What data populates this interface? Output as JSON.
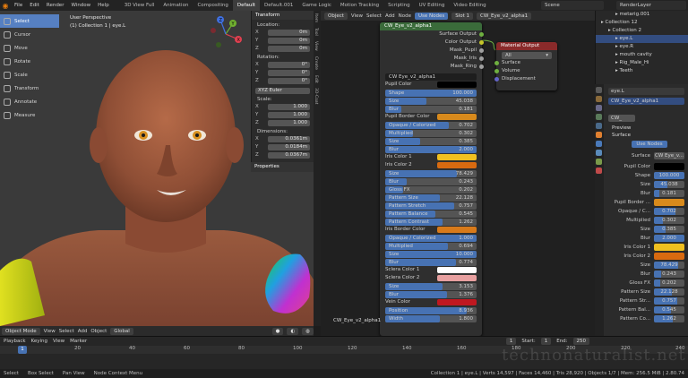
{
  "menubar": {
    "items": [
      "File",
      "Edit",
      "Render",
      "Window",
      "Help"
    ],
    "workspaces": [
      "3D View Full",
      "Animation",
      "Compositing",
      "Default",
      "Default.001",
      "Game Logic",
      "Motion Tracking",
      "Scripting",
      "UV Editing",
      "Video Editing"
    ],
    "active_workspace": "Default",
    "scene": "Scene",
    "view_layer": "RenderLayer"
  },
  "viewport": {
    "tools": [
      "Select",
      "Cursor",
      "Move",
      "Rotate",
      "Scale",
      "Transform",
      "Annotate",
      "Measure"
    ],
    "active_tool": "Select",
    "info_line1": "User Perspective",
    "info_line2": "(1) Collection 1 | eye.L",
    "mode": "Object Mode",
    "menu": [
      "View",
      "Select",
      "Add",
      "Object"
    ],
    "orientation": "Global",
    "gizmo_axes": [
      "X",
      "Y",
      "Z"
    ]
  },
  "npanel": {
    "title": "Transform",
    "location_label": "Location:",
    "location": [
      {
        "k": "X",
        "v": "0m"
      },
      {
        "k": "Y",
        "v": "0m"
      },
      {
        "k": "Z",
        "v": "0m"
      }
    ],
    "rotation_label": "Rotation:",
    "rotation": [
      {
        "k": "X",
        "v": "0°"
      },
      {
        "k": "Y",
        "v": "0°"
      },
      {
        "k": "Z",
        "v": "0°"
      }
    ],
    "rotation_mode": "XYZ Euler",
    "scale_label": "Scale:",
    "scale": [
      {
        "k": "X",
        "v": "1.000"
      },
      {
        "k": "Y",
        "v": "1.000"
      },
      {
        "k": "Z",
        "v": "1.000"
      }
    ],
    "dimensions_label": "Dimensions:",
    "dimensions": [
      {
        "k": "X",
        "v": "0.0361m"
      },
      {
        "k": "Y",
        "v": "0.0184m"
      },
      {
        "k": "Z",
        "v": "0.0367m"
      }
    ],
    "properties_title": "Properties",
    "tabs": [
      "Item",
      "Tool",
      "View",
      "Create",
      "Edit",
      "3D-Coat"
    ]
  },
  "node_editor": {
    "header": [
      "Object",
      "View",
      "Select",
      "Add",
      "Node",
      "Use Nodes"
    ],
    "slot": "Slot 1",
    "material": "CW_Eye_v2_alpha1",
    "group_node": {
      "title": "CW_Eye_v2_alpha1",
      "outputs": [
        "Surface Output",
        "Color Output",
        "Mask_Pupil",
        "Mask_Iris",
        "Mask_Ring"
      ],
      "datablock": "CW Eye_v2_alpha1",
      "params": [
        {
          "type": "color",
          "label": "Pupil Color",
          "color": "#000000"
        },
        {
          "type": "field",
          "label": "Shape",
          "value": "100.000",
          "fill": 1.0
        },
        {
          "type": "field",
          "label": "Size",
          "value": "45.038",
          "fill": 0.45
        },
        {
          "type": "field",
          "label": "Blur",
          "value": "0.181",
          "fill": 0.18
        },
        {
          "type": "color",
          "label": "Pupil Border Color",
          "color": "#d88a1c"
        },
        {
          "type": "field",
          "label": "Opaque / Colorized",
          "value": "0.702",
          "fill": 0.7
        },
        {
          "type": "field",
          "label": "Multiplied",
          "value": "0.302",
          "fill": 0.3
        },
        {
          "type": "field",
          "label": "Size",
          "value": "0.385",
          "fill": 0.38
        },
        {
          "type": "field",
          "label": "Blur",
          "value": "2.000",
          "fill": 1.0
        },
        {
          "type": "color",
          "label": "Iris Color 1",
          "color": "#f0c020"
        },
        {
          "type": "color",
          "label": "Iris Color 2",
          "color": "#d86a10"
        },
        {
          "type": "field",
          "label": "Size",
          "value": "78.429",
          "fill": 0.78
        },
        {
          "type": "field",
          "label": "Blur",
          "value": "0.243",
          "fill": 0.24
        },
        {
          "type": "field",
          "label": "Gloss FX",
          "value": "0.202",
          "fill": 0.2
        },
        {
          "type": "field",
          "label": "Pattern Size",
          "value": "22.128",
          "fill": 0.6
        },
        {
          "type": "field",
          "label": "Pattern Stretch",
          "value": "0.757",
          "fill": 0.75
        },
        {
          "type": "field",
          "label": "Pattern Balance",
          "value": "0.545",
          "fill": 0.55
        },
        {
          "type": "field",
          "label": "Pattern Contrast",
          "value": "1.262",
          "fill": 0.63
        },
        {
          "type": "color",
          "label": "Iris Border Color",
          "color": "#d87a1a"
        },
        {
          "type": "field",
          "label": "Opaque / Colorized",
          "value": "1.000",
          "fill": 1.0
        },
        {
          "type": "field",
          "label": "Multiplied",
          "value": "0.694",
          "fill": 0.69
        },
        {
          "type": "field",
          "label": "Size",
          "value": "10.000",
          "fill": 1.0
        },
        {
          "type": "field",
          "label": "Blur",
          "value": "0.774",
          "fill": 0.77
        },
        {
          "type": "color",
          "label": "Sclera Color 1",
          "color": "#ffffff"
        },
        {
          "type": "color",
          "label": "Sclera Color 2",
          "color": "#e8a0a0"
        },
        {
          "type": "field",
          "label": "Size",
          "value": "3.153",
          "fill": 0.63
        },
        {
          "type": "field",
          "label": "Blur",
          "value": "1.376",
          "fill": 0.68
        },
        {
          "type": "color",
          "label": "Vein Color",
          "color": "#c01820"
        },
        {
          "type": "field",
          "label": "Position",
          "value": "8.936",
          "fill": 0.89
        },
        {
          "type": "field",
          "label": "Width",
          "value": "1.800",
          "fill": 0.6
        }
      ]
    },
    "material_node": {
      "title": "Material Output",
      "target": "All",
      "inputs": [
        "Surface",
        "Volume",
        "Displacement"
      ]
    },
    "footer_label": "CW_Eye_v2_alpha1"
  },
  "outliner": {
    "rows": [
      {
        "label": "metarig.001",
        "sel": false,
        "indent": 2
      },
      {
        "label": "Collection 12",
        "sel": false,
        "indent": 0
      },
      {
        "label": "Collection 2",
        "sel": false,
        "indent": 1
      },
      {
        "label": "eye.L",
        "sel": true,
        "indent": 2
      },
      {
        "label": "eye.R",
        "sel": false,
        "indent": 2
      },
      {
        "label": "mouth cavity",
        "sel": false,
        "indent": 2
      },
      {
        "label": "Rig_Male_Hi",
        "sel": false,
        "indent": 2
      },
      {
        "label": "Teeth",
        "sel": false,
        "indent": 2
      }
    ]
  },
  "properties": {
    "object": "eye.L",
    "material_slot": "CW_Eye_v2_alpha1",
    "material_field": "CW_",
    "preview": "Preview",
    "surface": "Surface",
    "use_nodes": "Use Nodes",
    "surface_label": "Surface",
    "surface_value": "CW Eye_v...",
    "rows": [
      {
        "k": "Pupil Color",
        "type": "color",
        "color": "#000000"
      },
      {
        "k": "Shape",
        "v": "100.000",
        "fill": 1.0
      },
      {
        "k": "Size",
        "v": "45.038",
        "fill": 0.45
      },
      {
        "k": "Blur",
        "v": "0.181",
        "fill": 0.18
      },
      {
        "k": "Pupil Border ...",
        "type": "color",
        "color": "#d88a1c"
      },
      {
        "k": "Opaque / C...",
        "v": "0.702",
        "fill": 0.7
      },
      {
        "k": "Multiplied",
        "v": "0.302",
        "fill": 0.3
      },
      {
        "k": "Size",
        "v": "0.385",
        "fill": 0.38
      },
      {
        "k": "Blur",
        "v": "2.000",
        "fill": 1.0
      },
      {
        "k": "Iris Color 1",
        "type": "color",
        "color": "#f0c020"
      },
      {
        "k": "Iris Color 2",
        "type": "color",
        "color": "#d86a10"
      },
      {
        "k": "Size",
        "v": "78.429",
        "fill": 0.78
      },
      {
        "k": "Blur",
        "v": "0.243",
        "fill": 0.24
      },
      {
        "k": "Gloss FX",
        "v": "0.202",
        "fill": 0.2
      },
      {
        "k": "Pattern Size",
        "v": "22.128",
        "fill": 0.6
      },
      {
        "k": "Pattern Str...",
        "v": "0.757",
        "fill": 0.75
      },
      {
        "k": "Pattern Bal...",
        "v": "0.545",
        "fill": 0.55
      },
      {
        "k": "Pattern Co...",
        "v": "1.262",
        "fill": 0.63
      }
    ]
  },
  "timeline": {
    "menu": [
      "Playback",
      "Keying",
      "View",
      "Marker"
    ],
    "current_frame": "1",
    "start_label": "Start:",
    "start": "1",
    "end_label": "End:",
    "end": "250",
    "ticks": [
      "0",
      "20",
      "40",
      "60",
      "80",
      "100",
      "120",
      "140",
      "160",
      "180",
      "200",
      "220",
      "240"
    ]
  },
  "statusbar": {
    "items": [
      "Select",
      "Box Select",
      "Pan View",
      "Node Context Menu"
    ],
    "stats": "Collection 1 | eye.L | Verts 14,597 | Faces 14,460 | Tris 28,920 | Objects 1/7 | Mem: 256.5 MiB | 2.80.74"
  },
  "watermark": "technonaturalist.net"
}
